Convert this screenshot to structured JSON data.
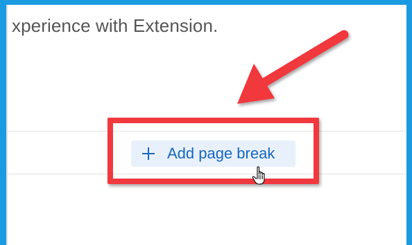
{
  "content": {
    "heading_partial": "xperience with Extension."
  },
  "toolbar": {
    "add_page_break_label": "Add page break",
    "add_page_break_icon": "plus-icon"
  },
  "annotation": {
    "arrow_icon": "red-arrow-icon",
    "highlight_color": "#f0393e"
  },
  "pointer": {
    "icon": "hand-pointer-icon"
  },
  "colors": {
    "frame": "#1a9ae0",
    "button_bg": "#e8f1fb",
    "button_text": "#1766c0",
    "heading_text": "#555555"
  }
}
